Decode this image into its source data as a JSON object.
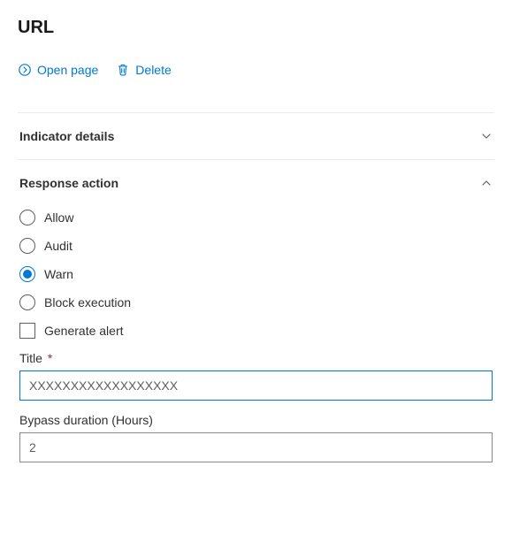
{
  "page": {
    "title": "URL"
  },
  "actions": {
    "open_page_label": "Open page",
    "delete_label": "Delete"
  },
  "sections": {
    "indicator_details": {
      "title": "Indicator details",
      "expanded": false
    },
    "response_action": {
      "title": "Response action",
      "expanded": true,
      "options": {
        "allow": "Allow",
        "audit": "Audit",
        "warn": "Warn",
        "block": "Block execution"
      },
      "selected": "warn",
      "generate_alert": {
        "label": "Generate alert",
        "checked": false
      },
      "title_field": {
        "label": "Title",
        "required": "*",
        "value": "XXXXXXXXXXXXXXXXXX"
      },
      "bypass_field": {
        "label": "Bypass duration (Hours)",
        "value": "2"
      }
    }
  }
}
